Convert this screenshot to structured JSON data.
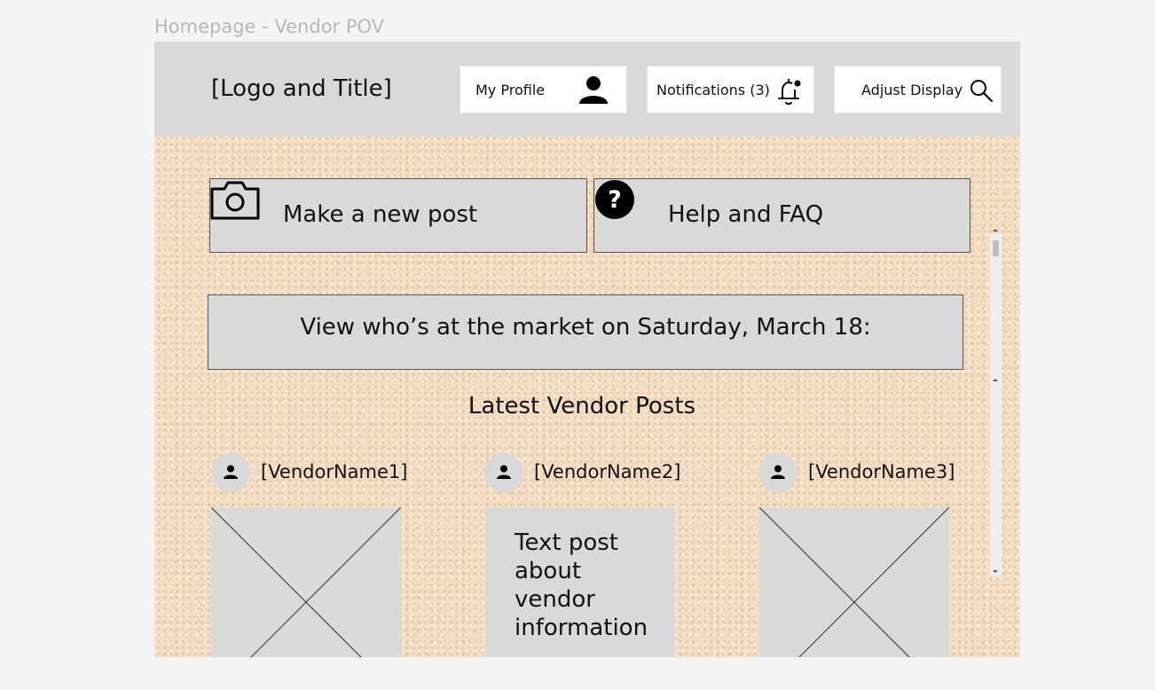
{
  "frame_label": "Homepage - Vendor POV",
  "header": {
    "logo_title": "[Logo and Title]",
    "buttons": {
      "profile": "My Profile",
      "notifications": "Notifications (3)",
      "adjust_display": "Adjust Display"
    },
    "icons": {
      "profile": "user-icon",
      "notifications": "bell-notification-icon",
      "adjust_display": "search-icon"
    }
  },
  "actions": {
    "new_post": "Make a new post",
    "help": "Help and FAQ",
    "icons": {
      "new_post": "camera-icon",
      "help": "question-icon"
    }
  },
  "market_banner": "View who’s at the market on Saturday, March 18:",
  "feed": {
    "title": "Latest Vendor Posts",
    "posts": [
      {
        "vendor": "[VendorName1]",
        "type": "image-placeholder"
      },
      {
        "vendor": "[VendorName2]",
        "type": "text",
        "text": "Text post about vendor information"
      },
      {
        "vendor": "[VendorName3]",
        "type": "image-placeholder"
      }
    ]
  },
  "colors": {
    "header_bg": "#d9d9d9",
    "board_bg": "#f3dcc0",
    "button_bg": "#d9d9d9",
    "label_gray": "#b7b7b7"
  }
}
